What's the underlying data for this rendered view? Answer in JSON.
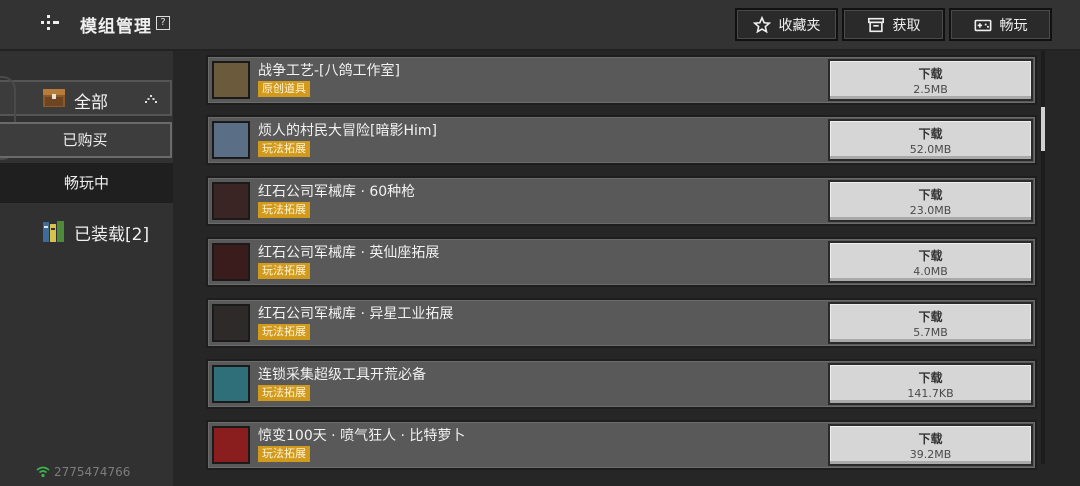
{
  "header": {
    "title": "模组管理",
    "help_icon": "?",
    "favorites_label": "收藏夹",
    "get_label": "获取",
    "play_label": "畅玩"
  },
  "sidebar": {
    "all_label": "全部",
    "purchased_label": "已购买",
    "playing_label": "畅玩中",
    "installed_label": "已装载[2]",
    "user_id": "2775474766"
  },
  "mods": [
    {
      "name": "战争工艺-[八鸽工作室]",
      "tag": "原创道具",
      "button": "下载",
      "size": "2.5MB",
      "thumb_color": "#6b5a3c"
    },
    {
      "name": "烦人的村民大冒险[暗影Him]",
      "tag": "玩法拓展",
      "button": "下载",
      "size": "52.0MB",
      "thumb_color": "#5a6f86"
    },
    {
      "name": "红石公司军械库 · 60种枪",
      "tag": "玩法拓展",
      "button": "下载",
      "size": "23.0MB",
      "thumb_color": "#3a2424"
    },
    {
      "name": "红石公司军械库 · 英仙座拓展",
      "tag": "玩法拓展",
      "button": "下载",
      "size": "4.0MB",
      "thumb_color": "#3b1c1c"
    },
    {
      "name": "红石公司军械库 · 异星工业拓展",
      "tag": "玩法拓展",
      "button": "下载",
      "size": "5.7MB",
      "thumb_color": "#2e2a2a"
    },
    {
      "name": "连锁采集超级工具开荒必备",
      "tag": "玩法拓展",
      "button": "下载",
      "size": "141.7KB",
      "thumb_color": "#2f6f7a"
    },
    {
      "name": "惊变100天 · 喷气狂人 · 比特萝卜",
      "tag": "玩法拓展",
      "button": "下载",
      "size": "39.2MB",
      "thumb_color": "#8a1e1e"
    }
  ]
}
